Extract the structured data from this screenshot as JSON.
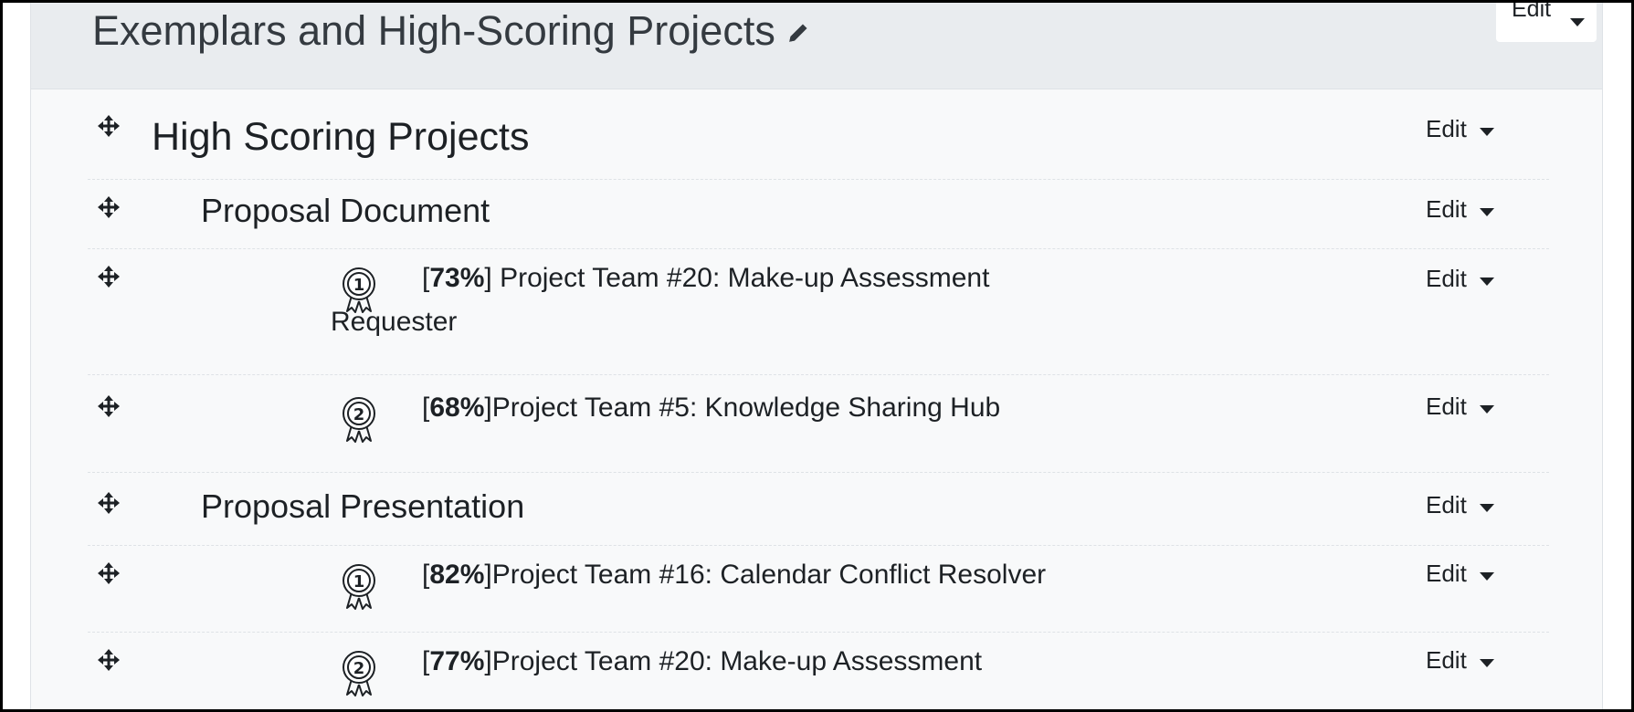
{
  "section": {
    "title": "Exemplars and High-Scoring Projects",
    "edit_label": "Edit"
  },
  "items": [
    {
      "type": "heading",
      "label": "High Scoring Projects",
      "edit": "Edit"
    },
    {
      "type": "subheading",
      "label": "Proposal Document",
      "edit": "Edit"
    },
    {
      "type": "project",
      "rank": 1,
      "pct": "73%",
      "label": " Project Team #20: Make-up Assessment",
      "continuation": "Requester",
      "edit": "Edit"
    },
    {
      "type": "project",
      "rank": 2,
      "pct": "68%",
      "label": "Project Team #5: Knowledge Sharing Hub",
      "edit": "Edit"
    },
    {
      "type": "subheading",
      "label": "Proposal Presentation",
      "edit": "Edit"
    },
    {
      "type": "project",
      "rank": 1,
      "pct": "82%",
      "label": "Project Team #16: Calendar Conflict Resolver",
      "edit": "Edit"
    },
    {
      "type": "project",
      "rank": 2,
      "pct": "77%",
      "label": "Project Team #20: Make-up Assessment",
      "edit": "Edit"
    }
  ],
  "icons": {
    "move": "move-icon",
    "award": "award-ribbon-icon",
    "pencil": "pencil-icon",
    "caret": "caret-down-icon"
  },
  "colors": {
    "header_bg": "#e9ecef",
    "card_bg": "#f8f9fa",
    "text": "#1d2125"
  }
}
